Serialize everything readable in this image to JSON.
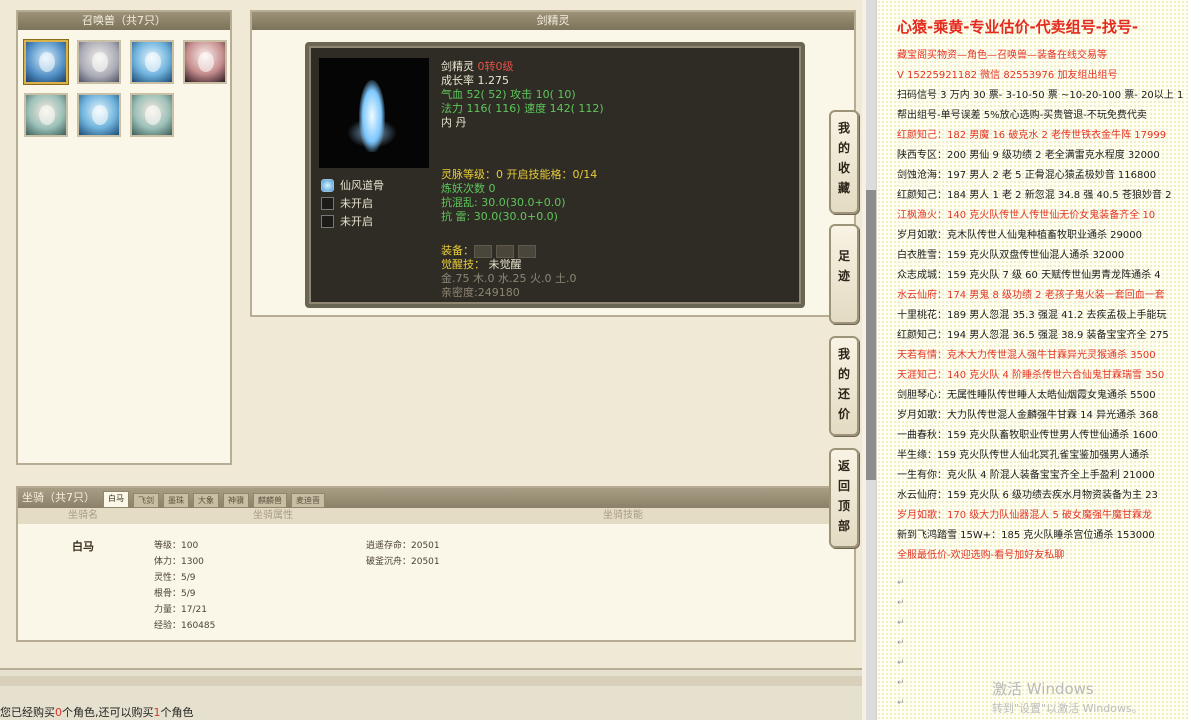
{
  "summon_panel": {
    "title": "召唤兽（共7只）",
    "avatars": [
      "avatar-1",
      "avatar-2",
      "avatar-3",
      "avatar-4",
      "avatar-5",
      "avatar-6",
      "avatar-7"
    ]
  },
  "detail_panel": {
    "title": "剑精灵",
    "pet_name": "剑精灵",
    "pet_rebirth": "0转0级",
    "growth": "成长率 1.275",
    "hp_label": "气血",
    "hp_val": "52( 52)",
    "atk_label": "攻击",
    "atk_val": "10( 10)",
    "mp_label": "法力",
    "mp_val": "116( 116)",
    "speed_label": "速度",
    "speed_val": "142( 112)",
    "neidan": "内    丹",
    "skills": [
      "仙风道骨",
      "未开启",
      "未开启"
    ],
    "spirit_level": "灵脉等级：0 开启技能格：0/14",
    "refine_count": "炼妖次数 0",
    "resist_chaos": "抗混乱: 30.0(30.0+0.0)",
    "resist_thunder": "抗    雷: 30.0(30.0+0.0)",
    "equip_label": "装备",
    "awaken_label": "觉醒技",
    "awaken_val": "未觉醒",
    "elements": "金.75 木.0 水.25 火.0 土.0",
    "intimacy": "亲密度:249180"
  },
  "mount_panel": {
    "title": "坐骑（共7只）",
    "tabs": [
      "白马",
      "飞剑",
      "墨珠",
      "大象",
      "神骥",
      "麒麟兽",
      "麦迪晋"
    ],
    "col_name": "坐骑名",
    "col_attr": "坐骑属性",
    "col_skill": "坐骑技能",
    "name": "白马",
    "attrs": [
      "等级：100",
      "体力：1300",
      "灵性：5/9",
      "根骨：5/9",
      "力量：17/21",
      "经验：160485"
    ],
    "attrs2": [
      "逍遥存命：20501",
      "破釜沉舟：20501"
    ]
  },
  "sidenav": {
    "collect": "我的收藏",
    "footprint": "足迹",
    "bargain": "我的还价",
    "top": "返回顶部"
  },
  "status": {
    "prefix": "您已经购买",
    "bought": "0",
    "mid": "个角色,还可以购买",
    "left": "1",
    "suffix": "个角色"
  },
  "doc": {
    "title": "心猿-乘黄-专业估价-代卖组号-找号-",
    "lines": [
      {
        "t": "藏宝阁买物资—角色—召唤兽—装备在线交易等",
        "red": true
      },
      {
        "t": "V 15225921182  微信 82553976 加友组出组号",
        "red": true
      },
      {
        "t": "扫码信号 3 万内 30 票- 3-10-50 票  ~10-20-100 票- 20以上 1",
        "red": false
      },
      {
        "t": "帮出组号-单号误差 5%放心选购-买贵管退-不玩免费代卖",
        "red": false
      },
      {
        "t": "红颜知己：182 男魔 16 破克水 2 老传世铁衣金牛阵 17999",
        "red": true
      },
      {
        "t": "陕西专区：200 男仙 9 级功绩 2 老全满雷克水程度 32000",
        "red": false
      },
      {
        "t": "剑蚀沧海：197 男人 2 老 5 正骨混心猿孟极妙音 116800",
        "red": false
      },
      {
        "t": "红颜知己：184 男人 1 老 2 新忽混 34.8 强 40.5 苍狼妙音 2",
        "red": false
      },
      {
        "t": "江枫渔火：140 克火队传世人传世仙无价女鬼装备齐全 10",
        "red": true
      },
      {
        "t": "岁月如歌：克木队传世人仙鬼种植畜牧职业通杀 29000",
        "red": false
      },
      {
        "t": "白衣胜雪：159 克火队双盘传世仙混人通杀 32000",
        "red": false
      },
      {
        "t": "众志成城：159 克火队 7 级 60 天赋传世仙男青龙阵通杀 4",
        "red": false
      },
      {
        "t": "水云仙府：174 男鬼 8 级功绩 2 老孩子鬼火装一套回血一套",
        "red": true
      },
      {
        "t": "十里桃花：189 男人忽混 35.3 强混 41.2 去疾孟极上手能玩",
        "red": false
      },
      {
        "t": "红颜知己：194 男人忽混 36.5 强混 38.9 装备宝宝齐全 275",
        "red": false
      },
      {
        "t": "天若有情：克木大力传世混人强牛甘霖异光灵猴通杀 3500",
        "red": true
      },
      {
        "t": "天涯知己：140 克火队 4 阶睡杀传世六合仙鬼甘霖瑞雪 350",
        "red": true
      },
      {
        "t": "剑胆琴心：无属性睡队传世睡人太皓仙烟霞女鬼通杀 5500",
        "red": false
      },
      {
        "t": "岁月如歌：大力队传世混人金麟强牛甘霖 14 异光通杀 368",
        "red": false
      },
      {
        "t": "一曲春秋：159 克火队畜牧职业传世男人传世仙通杀 1600",
        "red": false
      },
      {
        "t": "半生缘：159 克火队传世人仙北冥孔雀宝鉴加强男人通杀",
        "red": false
      },
      {
        "t": "一生有你：克火队 4 阶混人装备宝宝齐全上手盈利 21000",
        "red": false
      },
      {
        "t": "水云仙府：159 克火队 6 级功绩去疾水月物资装备为主 23",
        "red": false
      },
      {
        "t": "岁月如歌：170 级大力队仙器混人 5 破女魔强牛魔甘霖龙",
        "red": true
      },
      {
        "t": "新到飞鸿踏雪 15W+：185 克火队睡杀宫位通杀 153000",
        "red": false
      },
      {
        "t": "全服最低价-欢迎选购-看号加好友私聊",
        "red": true
      }
    ],
    "watermark": "激活 Windows",
    "watermark_sub": "转到\"设置\"以激活 Windows。"
  }
}
